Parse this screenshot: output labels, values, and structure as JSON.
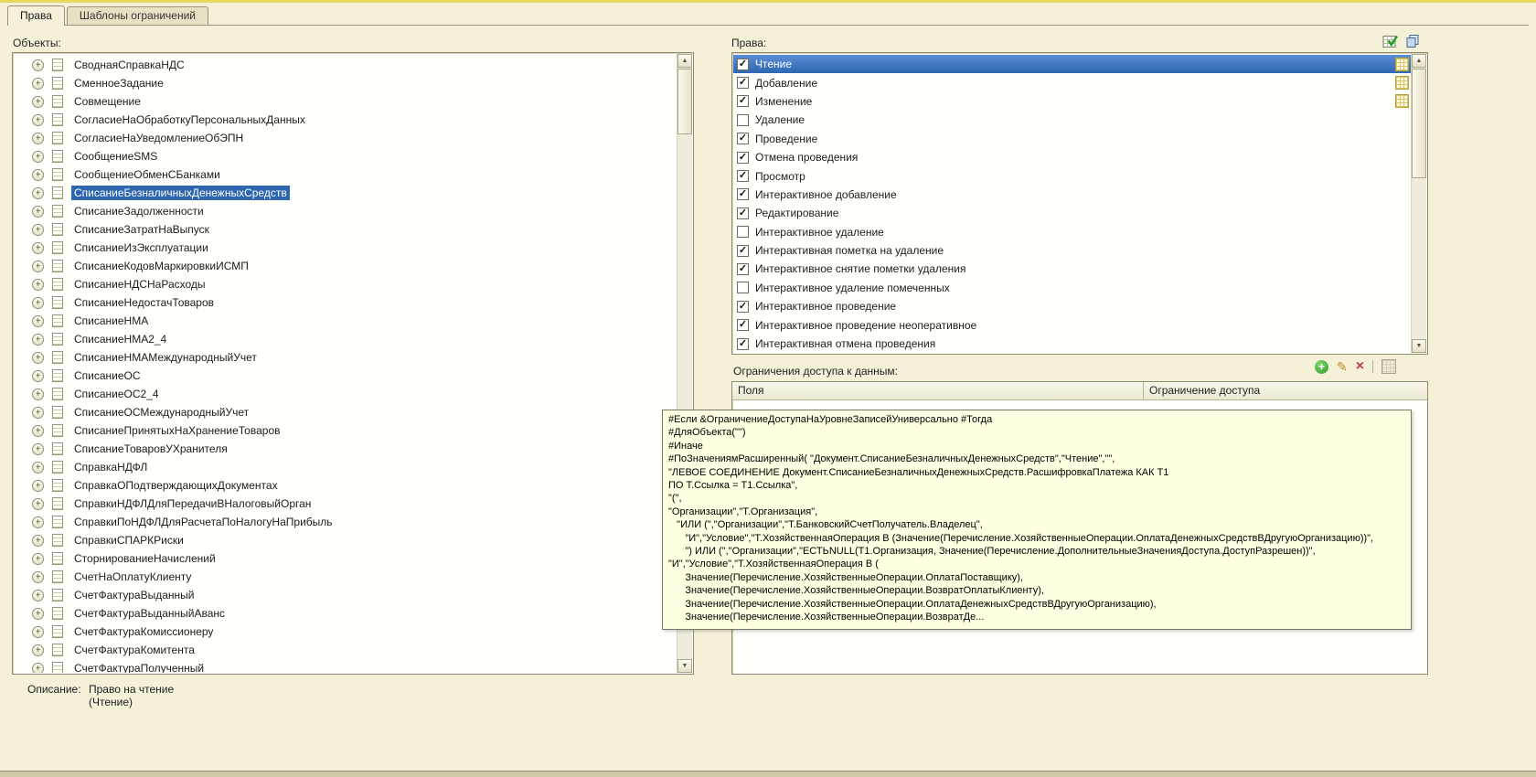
{
  "colors": {
    "selection": "#2e66b0",
    "page_bg": "#f5f1d8",
    "tooltip_bg": "#ffffe1"
  },
  "tabs": {
    "rights": "Права",
    "templates": "Шаблоны ограничений"
  },
  "icons": {
    "enable_all_rights": "table-check",
    "copy_rights": "stacked-windows",
    "add": "+",
    "edit": "✎",
    "delete": "×",
    "restriction_template": "grid",
    "scroll_up": "▲",
    "scroll_down": "▼",
    "checkbox_check": "✓",
    "tree_expand": "+"
  },
  "objects": {
    "label": "Объекты:",
    "items": [
      {
        "label": "СводнаяСправкаНДС"
      },
      {
        "label": "СменноеЗадание"
      },
      {
        "label": "Совмещение"
      },
      {
        "label": "СогласиеНаОбработкуПерсональныхДанных"
      },
      {
        "label": "СогласиеНаУведомлениеОбЭПН"
      },
      {
        "label": "СообщениеSMS"
      },
      {
        "label": "СообщениеОбменСБанками"
      },
      {
        "label": "СписаниеБезналичныхДенежныхСредств",
        "selected": true
      },
      {
        "label": "СписаниеЗадолженности"
      },
      {
        "label": "СписаниеЗатратНаВыпуск"
      },
      {
        "label": "СписаниеИзЭксплуатации"
      },
      {
        "label": "СписаниеКодовМаркировкиИСМП"
      },
      {
        "label": "СписаниеНДСНаРасходы"
      },
      {
        "label": "СписаниеНедостачТоваров"
      },
      {
        "label": "СписаниеНМА"
      },
      {
        "label": "СписаниеНМА2_4"
      },
      {
        "label": "СписаниеНМАМеждународныйУчет"
      },
      {
        "label": "СписаниеОС"
      },
      {
        "label": "СписаниеОС2_4"
      },
      {
        "label": "СписаниеОСМеждународныйУчет"
      },
      {
        "label": "СписаниеПринятыхНаХранениеТоваров"
      },
      {
        "label": "СписаниеТоваровУХранителя"
      },
      {
        "label": "СправкаНДФЛ"
      },
      {
        "label": "СправкаОПодтверждающихДокументах"
      },
      {
        "label": "СправкиНДФЛДляПередачиВНалоговыйОрган"
      },
      {
        "label": "СправкиПоНДФЛДляРасчетаПоНалогуНаПрибыль"
      },
      {
        "label": "СправкиСПАРКРиски"
      },
      {
        "label": "СторнированиеНачислений"
      },
      {
        "label": "СчетНаОплатуКлиенту"
      },
      {
        "label": "СчетФактураВыданный"
      },
      {
        "label": "СчетФактураВыданныйАванс"
      },
      {
        "label": "СчетФактураКомиссионеру"
      },
      {
        "label": "СчетФактураКомитента"
      },
      {
        "label": "СчетФактураПолученный"
      }
    ]
  },
  "rights": {
    "label": "Права:",
    "items": [
      {
        "label": "Чтение",
        "checked": true,
        "selected": true,
        "restriction": true
      },
      {
        "label": "Добавление",
        "checked": true,
        "restriction": true
      },
      {
        "label": "Изменение",
        "checked": true,
        "restriction": true
      },
      {
        "label": "Удаление",
        "checked": false
      },
      {
        "label": "Проведение",
        "checked": true
      },
      {
        "label": "Отмена проведения",
        "checked": true
      },
      {
        "label": "Просмотр",
        "checked": true
      },
      {
        "label": "Интерактивное добавление",
        "checked": true
      },
      {
        "label": "Редактирование",
        "checked": true
      },
      {
        "label": "Интерактивное удаление",
        "checked": false
      },
      {
        "label": "Интерактивная пометка на удаление",
        "checked": true
      },
      {
        "label": "Интерактивное снятие пометки удаления",
        "checked": true
      },
      {
        "label": "Интерактивное удаление помеченных",
        "checked": false
      },
      {
        "label": "Интерактивное проведение",
        "checked": true
      },
      {
        "label": "Интерактивное проведение неоперативное",
        "checked": true
      },
      {
        "label": "Интерактивная отмена проведения",
        "checked": true
      }
    ]
  },
  "restrictions": {
    "label": "Ограничения доступа к данным:",
    "columns": [
      "Поля",
      "Ограничение доступа"
    ]
  },
  "tooltip": {
    "lines": [
      "#Если &ОграничениеДоступаНаУровнеЗаписейУниверсально #Тогда",
      "#ДляОбъекта(\"\")",
      "#Иначе",
      "#ПоЗначениямРасширенный( \"Документ.СписаниеБезналичныхДенежныхСредств\",\"Чтение\",\"\",",
      "\"ЛЕВОЕ СОЕДИНЕНИЕ Документ.СписаниеБезналичныхДенежныхСредств.РасшифровкаПлатежа КАК Т1",
      "ПО Т.Ссылка = Т1.Ссылка\",",
      "\"(\",",
      "\"Организации\",\"Т.Организация\",",
      "   \"ИЛИ (\",\"Организации\",\"Т.БанковскийСчетПолучатель.Владелец\",",
      "      \"И\",\"Условие\",\"Т.ХозяйственнаяОперация В (Значение(Перечисление.ХозяйственныеОперации.ОплатаДенежныхСредствВДругуюОрганизацию))\",",
      "      \") ИЛИ (\",\"Организации\",\"ЕСТЬNULL(Т1.Организация, Значение(Перечисление.ДополнительныеЗначенияДоступа.ДоступРазрешен))\",",
      "\"И\",\"Условие\",\"Т.ХозяйственнаяОперация В (",
      "      Значение(Перечисление.ХозяйственныеОперации.ОплатаПоставщику),",
      "      Значение(Перечисление.ХозяйственныеОперации.ВозвратОплатыКлиенту),",
      "      Значение(Перечисление.ХозяйственныеОперации.ОплатаДенежныхСредствВДругуюОрганизацию),",
      "      Значение(Перечисление.ХозяйственныеОперации.ВозвратДе..."
    ]
  },
  "description": {
    "label": "Описание:",
    "line1": "Право на чтение",
    "line2": "(Чтение)"
  }
}
